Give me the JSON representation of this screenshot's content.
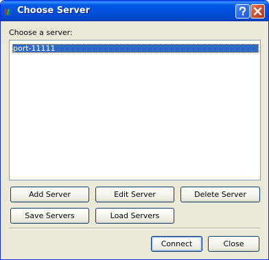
{
  "window": {
    "title": "Choose Server",
    "help_button": "?",
    "close_button": "X"
  },
  "prompt": "Choose a server:",
  "servers": [
    {
      "name": "port-11111",
      "selected": true
    }
  ],
  "buttons": {
    "add": "Add Server",
    "edit": "Edit Server",
    "delete": "Delete Server",
    "save": "Save Servers",
    "load": "Load Servers",
    "connect": "Connect",
    "close": "Close"
  },
  "icons": {
    "app": "paraview-app-icon",
    "help": "question-mark-icon",
    "close": "close-x-icon"
  },
  "colors": {
    "titlebar": "#0054E3",
    "selection": "#316AC5",
    "dialog_bg": "#ECE9D8"
  }
}
